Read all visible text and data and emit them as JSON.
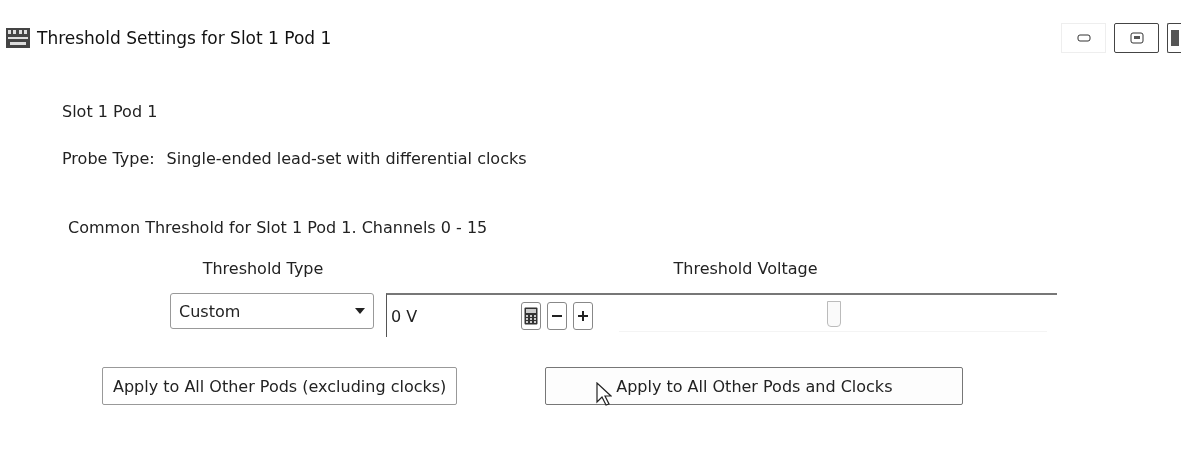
{
  "window": {
    "title": "Threshold Settings for Slot 1 Pod 1"
  },
  "pod_label": "Slot 1 Pod 1",
  "probe_type": {
    "label": "Probe Type:",
    "value": "Single-ended lead-set with differential clocks"
  },
  "common_threshold": {
    "title": "Common Threshold for Slot 1 Pod 1. Channels 0 - 15",
    "type_header": "Threshold Type",
    "voltage_header": "Threshold Voltage",
    "type": {
      "value": "Custom"
    },
    "voltage": {
      "value": "0 V",
      "level": 0.5
    }
  },
  "buttons": [
    {
      "label": "Apply to All Other Pods (excluding clocks)",
      "hovered": false
    },
    {
      "label": "Apply to All Other Pods and Clocks",
      "hovered": true
    }
  ]
}
